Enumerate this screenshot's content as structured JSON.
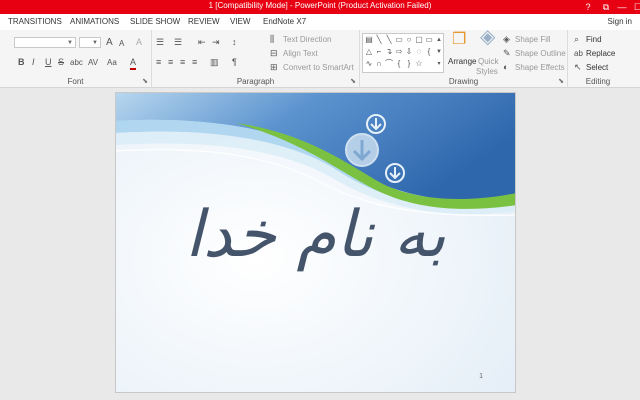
{
  "window": {
    "title": "1 [Compatibility Mode] -  PowerPoint (Product Activation Failed)",
    "help_glyph": "?",
    "restore_glyph": "⧉",
    "minimize_glyph": "—",
    "maximize_glyph": "☐"
  },
  "tabs": [
    "TRANSITIONS",
    "ANIMATIONS",
    "SLIDE SHOW",
    "REVIEW",
    "VIEW",
    "EndNote X7"
  ],
  "account": {
    "signin_label": "Sign in"
  },
  "ribbon": {
    "font": {
      "label": "Font",
      "bold": "B",
      "italic": "I",
      "underline": "U",
      "strike": "S",
      "shadow": "abc",
      "spacing": "AV",
      "case": "Aa",
      "color": "A",
      "grow": "A",
      "shrink": "A",
      "clear": "A"
    },
    "paragraph": {
      "label": "Paragraph",
      "text_direction": "Text Direction",
      "align_text": "Align Text",
      "convert_smartart": "Convert to SmartArt"
    },
    "drawing": {
      "label": "Drawing",
      "arrange": "Arrange",
      "quick_styles_1": "Quick",
      "quick_styles_2": "Styles",
      "shape_fill": "Shape Fill",
      "shape_outline": "Shape Outline",
      "shape_effects": "Shape Effects"
    },
    "editing": {
      "label": "Editing",
      "find": "Find",
      "replace": "Replace",
      "select": "Select"
    }
  },
  "slide": {
    "title_text": "به نام خدا",
    "number": "1"
  },
  "colors": {
    "titlebar": "#e60012",
    "slide_blue": "#4f86c6",
    "accent_green": "#7ac142",
    "calligraphy": "#44546a"
  }
}
